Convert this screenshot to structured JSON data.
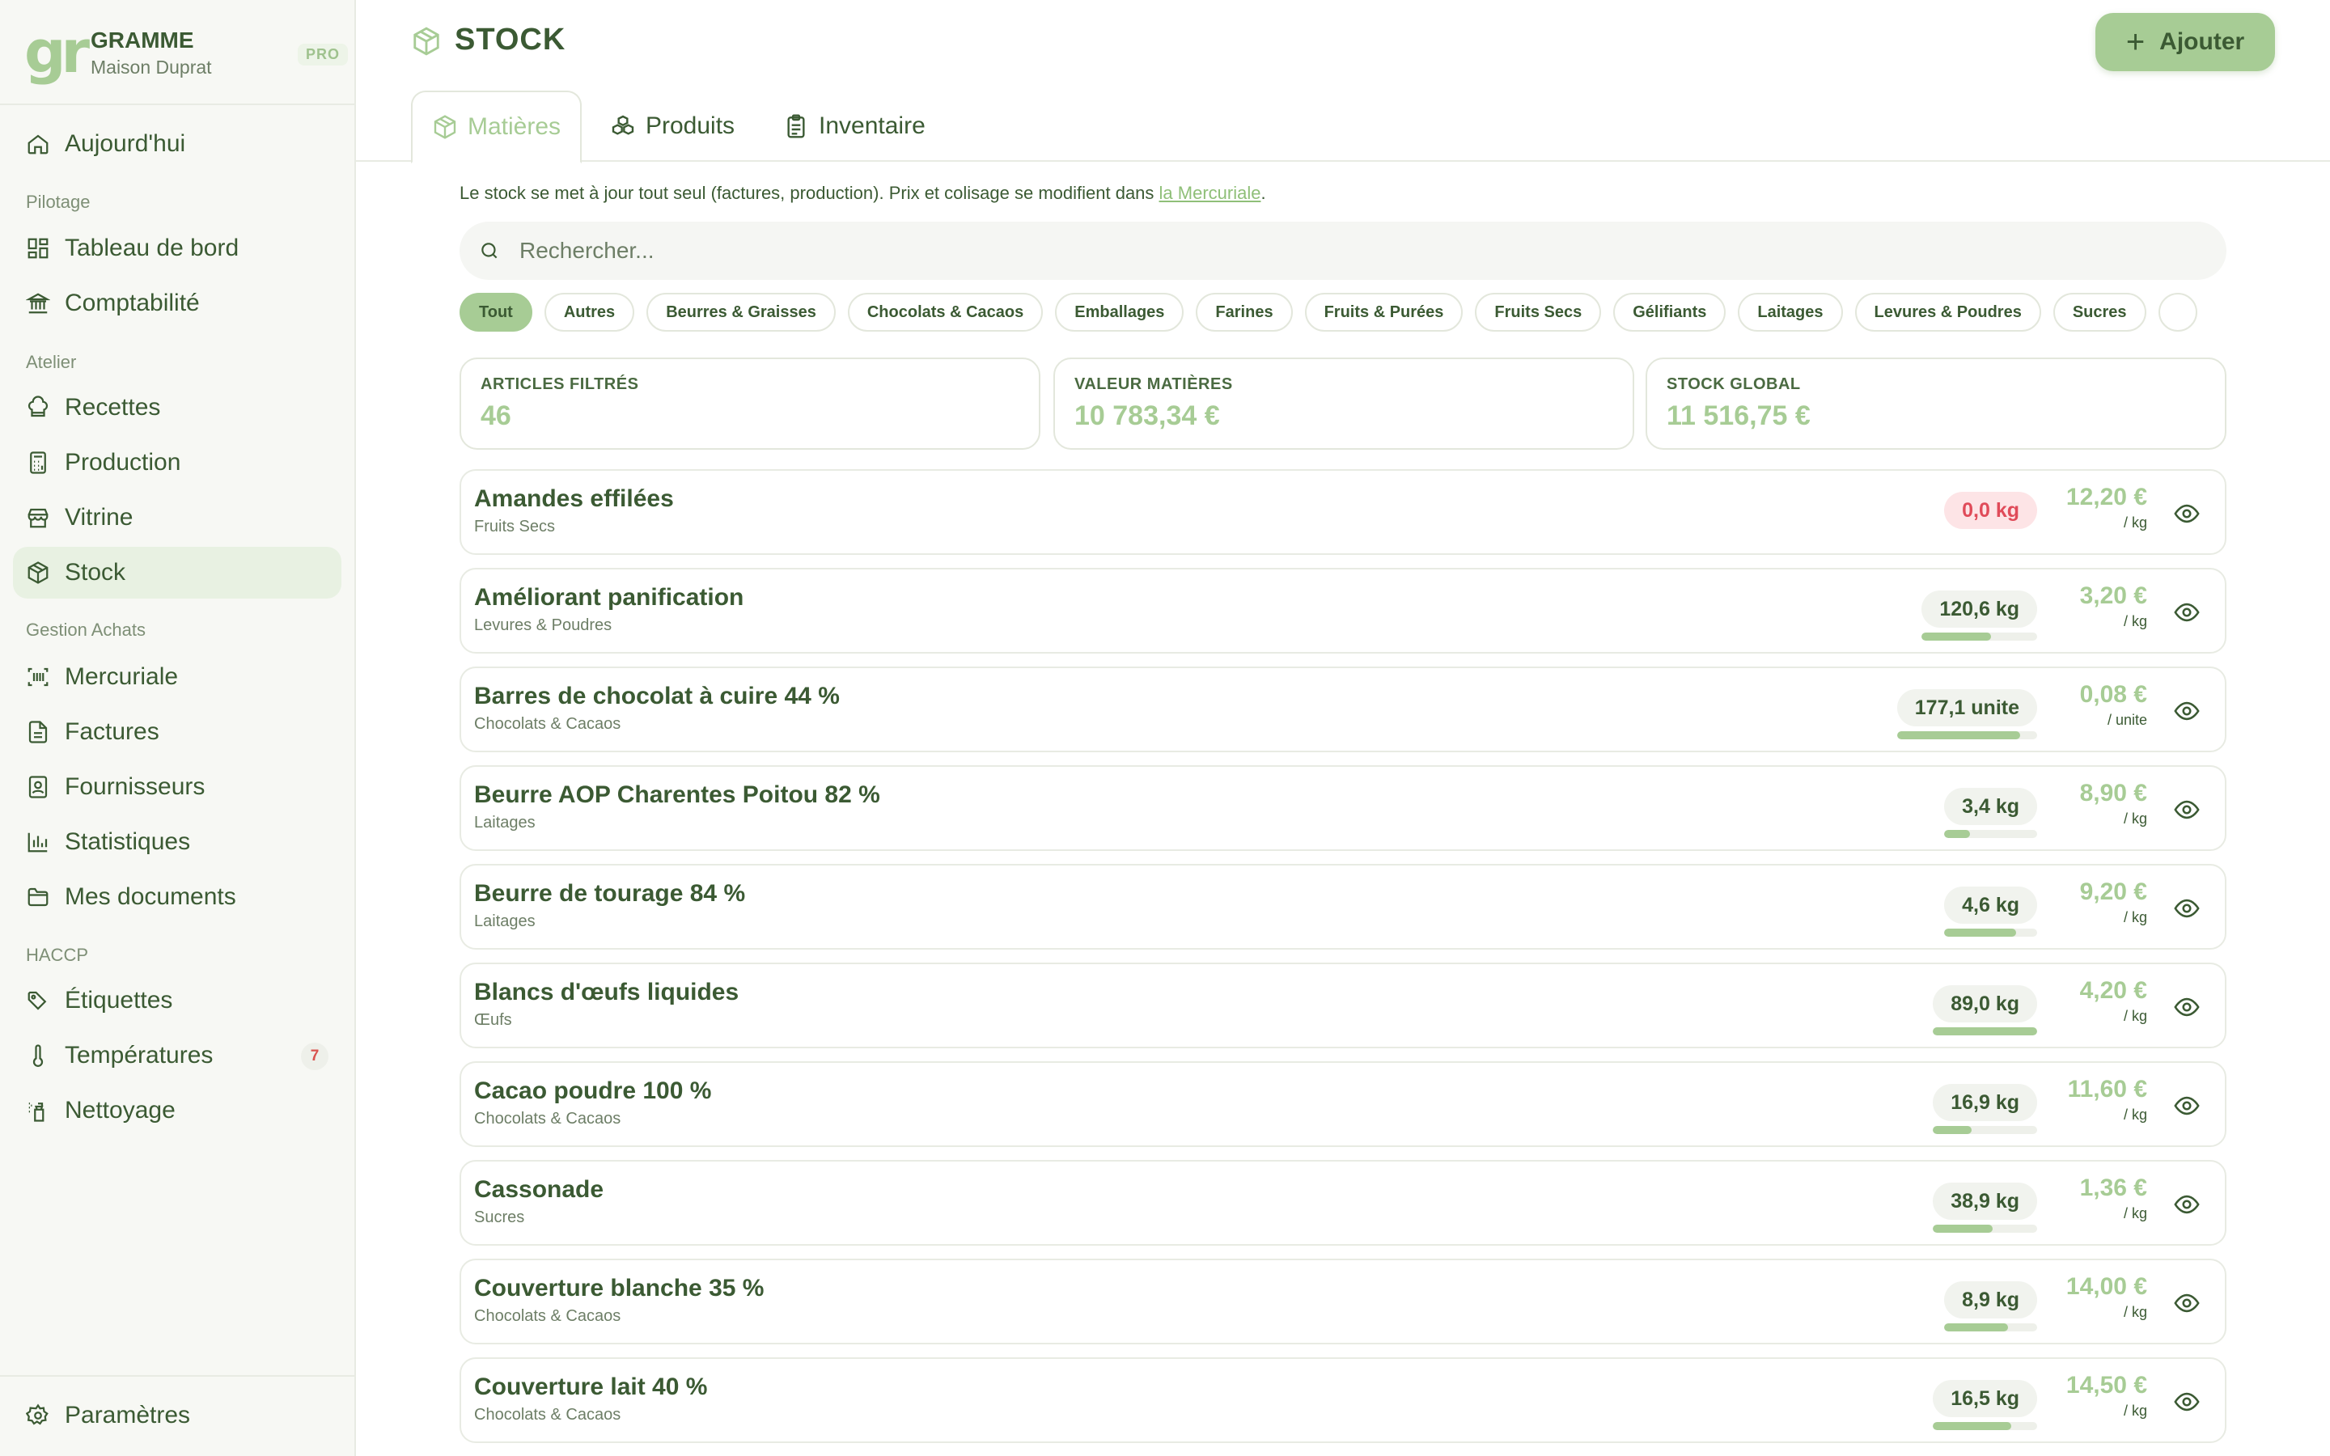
{
  "brand": {
    "logo": "gr",
    "name": "GRAMME",
    "subtitle": "Maison Duprat",
    "badge": "PRO"
  },
  "sidebar": {
    "today": "Aujourd'hui",
    "sections": {
      "pilotage": "Pilotage",
      "atelier": "Atelier",
      "achats": "Gestion Achats",
      "haccp": "HACCP"
    },
    "items": {
      "dashboard": "Tableau de bord",
      "accounting": "Comptabilité",
      "recipes": "Recettes",
      "production": "Production",
      "showcase": "Vitrine",
      "stock": "Stock",
      "mercuriale": "Mercuriale",
      "invoices": "Factures",
      "suppliers": "Fournisseurs",
      "statistics": "Statistiques",
      "documents": "Mes documents",
      "labels": "Étiquettes",
      "temperatures": "Températures",
      "temperatures_badge": "7",
      "cleaning": "Nettoyage"
    },
    "settings": "Paramètres"
  },
  "header": {
    "title": "STOCK",
    "add_label": "Ajouter",
    "tabs": {
      "materials": "Matières",
      "products": "Produits",
      "inventory": "Inventaire"
    }
  },
  "main": {
    "notice_text": "Le stock se met à jour tout seul (factures, production). Prix et colisage se modifient dans ",
    "notice_link": "la Mercuriale",
    "notice_end": ".",
    "search_placeholder": "Rechercher...",
    "chips": [
      "Tout",
      "Autres",
      "Beurres & Graisses",
      "Chocolats & Cacaos",
      "Emballages",
      "Farines",
      "Fruits & Purées",
      "Fruits Secs",
      "Gélifiants",
      "Laitages",
      "Levures & Poudres",
      "Sucres",
      ""
    ],
    "stats": [
      {
        "label": "ARTICLES FILTRÉS",
        "value": "46"
      },
      {
        "label": "VALEUR MATIÈRES",
        "value": "10 783,34 €"
      },
      {
        "label": "STOCK GLOBAL",
        "value": "11 516,75 €"
      }
    ],
    "items": [
      {
        "name": "Amandes effilées",
        "category": "Fruits Secs",
        "qty": "0,0 kg",
        "level": 0,
        "empty": true,
        "price": "12,20 €",
        "unit": "/ kg"
      },
      {
        "name": "Améliorant panification",
        "category": "Levures & Poudres",
        "qty": "120,6 kg",
        "level": 0.6,
        "empty": false,
        "price": "3,20 €",
        "unit": "/ kg"
      },
      {
        "name": "Barres de chocolat à cuire 44 %",
        "category": "Chocolats & Cacaos",
        "qty": "177,1 unite",
        "level": 0.88,
        "empty": false,
        "price": "0,08 €",
        "unit": "/ unite"
      },
      {
        "name": "Beurre AOP Charentes Poitou 82 %",
        "category": "Laitages",
        "qty": "3,4 kg",
        "level": 0.28,
        "empty": false,
        "price": "8,90 €",
        "unit": "/ kg"
      },
      {
        "name": "Beurre de tourage 84 %",
        "category": "Laitages",
        "qty": "4,6 kg",
        "level": 0.77,
        "empty": false,
        "price": "9,20 €",
        "unit": "/ kg"
      },
      {
        "name": "Blancs d'œufs liquides",
        "category": "Œufs",
        "qty": "89,0 kg",
        "level": 1.0,
        "empty": false,
        "price": "4,20 €",
        "unit": "/ kg"
      },
      {
        "name": "Cacao poudre 100 %",
        "category": "Chocolats & Cacaos",
        "qty": "16,9 kg",
        "level": 0.37,
        "empty": false,
        "price": "11,60 €",
        "unit": "/ kg"
      },
      {
        "name": "Cassonade",
        "category": "Sucres",
        "qty": "38,9 kg",
        "level": 0.57,
        "empty": false,
        "price": "1,36 €",
        "unit": "/ kg"
      },
      {
        "name": "Couverture blanche 35 %",
        "category": "Chocolats & Cacaos",
        "qty": "8,9 kg",
        "level": 0.69,
        "empty": false,
        "price": "14,00 €",
        "unit": "/ kg"
      },
      {
        "name": "Couverture lait 40 %",
        "category": "Chocolats & Cacaos",
        "qty": "16,5 kg",
        "level": 0.75,
        "empty": false,
        "price": "14,50 €",
        "unit": "/ kg"
      }
    ]
  },
  "colors": {
    "accent": "#a7cc95",
    "text": "#3b5a33",
    "danger": "#e04b59",
    "danger_bg": "#fde4e6"
  }
}
